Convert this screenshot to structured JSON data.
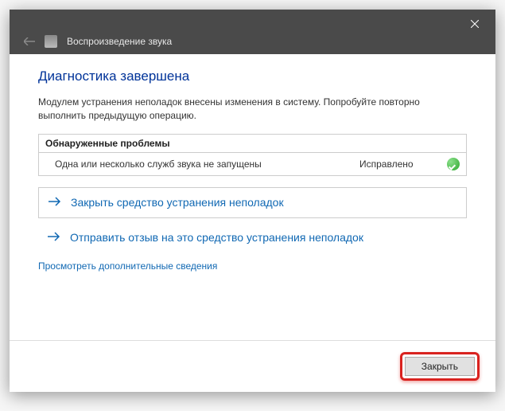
{
  "titlebar": {
    "title": "Воспроизведение звука"
  },
  "heading": "Диагностика завершена",
  "body": "Модулем устранения неполадок внесены изменения в систему. Попробуйте повторно выполнить предыдущую операцию.",
  "problems": {
    "header": "Обнаруженные проблемы",
    "items": [
      {
        "desc": "Одна или несколько служб звука не запущены",
        "status": "Исправлено"
      }
    ]
  },
  "actions": {
    "close_troubleshooter": "Закрыть средство устранения неполадок",
    "send_feedback": "Отправить отзыв на это средство устранения неполадок"
  },
  "details_link": "Просмотреть дополнительные сведения",
  "footer": {
    "close_label": "Закрыть"
  }
}
